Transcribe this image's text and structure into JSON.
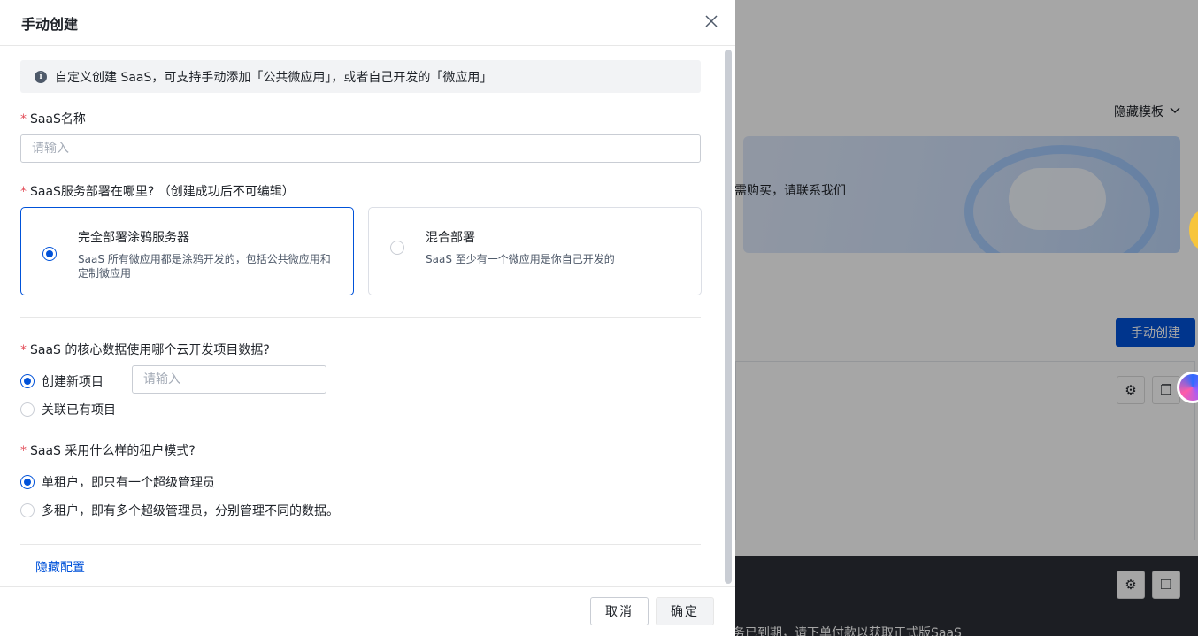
{
  "background": {
    "template_toggle": "隐藏模板",
    "banner_text": "需购买，请联系我们",
    "create_button": "手动创建",
    "expired_text": "体验服务已到期，请下单付款以获取正式版SaaS"
  },
  "dialog": {
    "title": "手动创建",
    "alert": "自定义创建 SaaS，可支持手动添加「公共微应用」，或者自己开发的「微应用」",
    "name_label": "SaaS名称",
    "name_placeholder": "请输入",
    "deploy_label": "SaaS服务部署在哪里? （创建成功后不可编辑）",
    "deploy_options": [
      {
        "title": "完全部署涂鸦服务器",
        "desc": "SaaS 所有微应用都是涂鸦开发的，包括公共微应用和定制微应用",
        "selected": true
      },
      {
        "title": "混合部署",
        "desc": "SaaS 至少有一个微应用是你自己开发的",
        "selected": false
      }
    ],
    "project_label": "SaaS 的核心数据使用哪个云开发项目数据?",
    "project_options": [
      {
        "label": "创建新项目",
        "selected": true
      },
      {
        "label": "关联已有项目",
        "selected": false
      }
    ],
    "project_placeholder": "请输入",
    "tenant_label": "SaaS 采用什么样的租户模式?",
    "tenant_options": [
      {
        "label": "单租户，即只有一个超级管理员",
        "selected": true
      },
      {
        "label": "多租户，即有多个超级管理员，分别管理不同的数据。",
        "selected": false
      }
    ],
    "hide_config": "隐藏配置",
    "cancel": "取消",
    "ok": "确定"
  },
  "colors": {
    "primary": "#0052d9",
    "required": "#e34d59"
  }
}
